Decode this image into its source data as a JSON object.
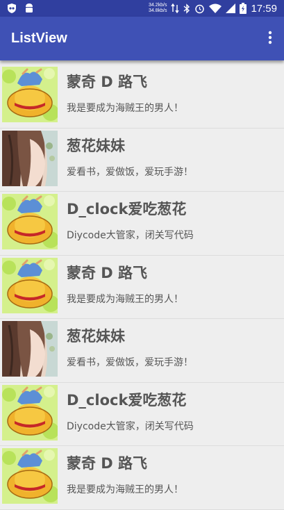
{
  "status_bar": {
    "net_up": "34.2kb/s",
    "net_down": "34.8kb/s",
    "time": "17:59"
  },
  "app_bar": {
    "title": "ListView",
    "menu_icon": "more-vert-icon"
  },
  "list": {
    "items": [
      {
        "name": "蒙奇 D 路飞",
        "desc": "我是要成为海贼王的男人！",
        "avatar": "straw-hat-avatar"
      },
      {
        "name": "葱花妹妹",
        "desc": "爱看书，爱做饭，爱玩手游！",
        "avatar": "girl-avatar"
      },
      {
        "name": "D_clock爱吃葱花",
        "desc": "Diycode大管家，闭关写代码",
        "avatar": "straw-hat-avatar"
      },
      {
        "name": "蒙奇 D 路飞",
        "desc": "我是要成为海贼王的男人！",
        "avatar": "straw-hat-avatar"
      },
      {
        "name": "葱花妹妹",
        "desc": "爱看书，爱做饭，爱玩手游！",
        "avatar": "girl-avatar"
      },
      {
        "name": "D_clock爱吃葱花",
        "desc": "Diycode大管家，闭关写代码",
        "avatar": "straw-hat-avatar"
      },
      {
        "name": "蒙奇 D 路飞",
        "desc": "我是要成为海贼王的男人！",
        "avatar": "straw-hat-avatar"
      }
    ]
  },
  "colors": {
    "status_bar": "#303f9f",
    "app_bar": "#3f51b5",
    "background": "#eeeeee",
    "text": "#555555"
  }
}
